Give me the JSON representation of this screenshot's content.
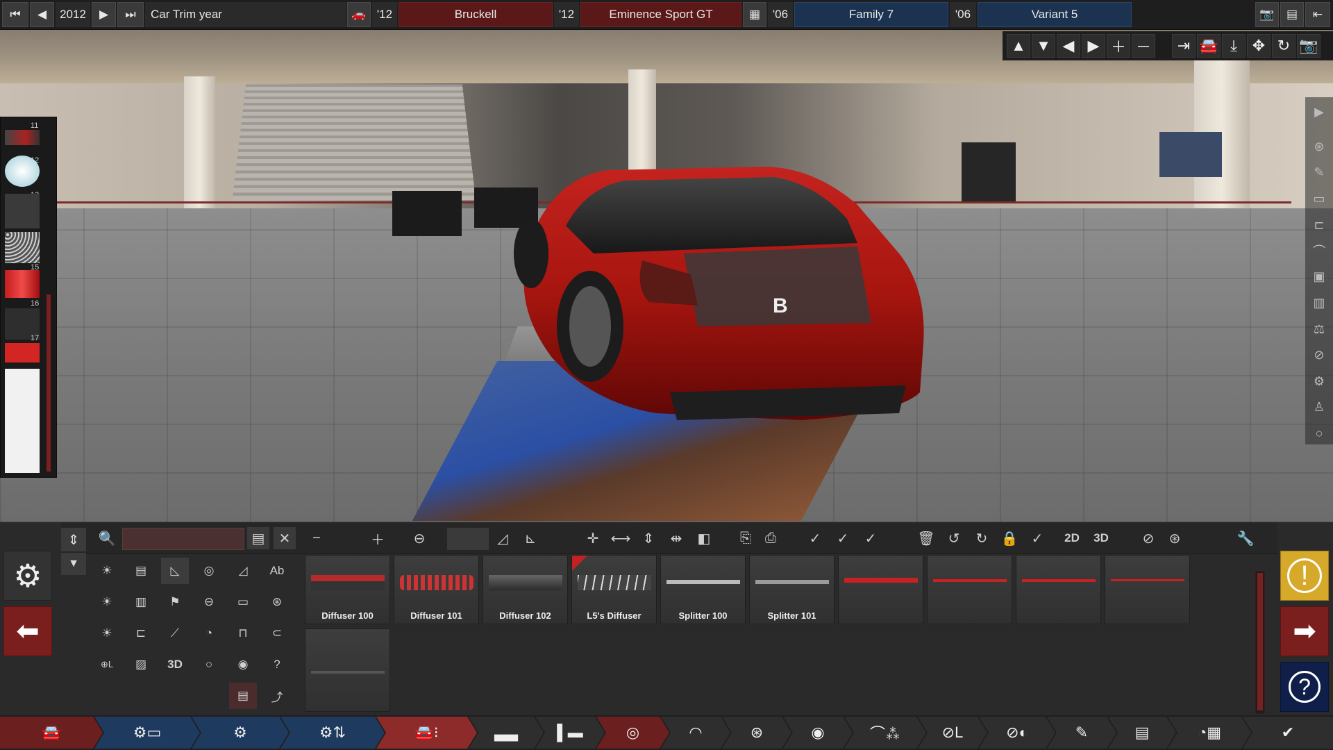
{
  "topbar": {
    "year": "2012",
    "year_label": "Car Trim year",
    "model_year": "'12",
    "model_name": "Bruckell",
    "trim_year": "'12",
    "trim_name": "Eminence Sport GT",
    "family_year": "'06",
    "family_name": "Family 7",
    "variant_year": "'06",
    "variant_name": "Variant 5"
  },
  "left_strip": {
    "swatches": [
      "11",
      "12",
      "13",
      "14",
      "15",
      "16",
      "17"
    ]
  },
  "toolbar": {
    "view_2d": "2D",
    "view_3d": "3D",
    "search_placeholder": ""
  },
  "categories": {
    "text_tool": "Ab",
    "three_d": "3D",
    "logo_label": "⊕L"
  },
  "parts": [
    {
      "name": "Diffuser 100"
    },
    {
      "name": "Diffuser 101"
    },
    {
      "name": "Diffuser 102"
    },
    {
      "name": "L5's Diffuser"
    },
    {
      "name": "Splitter 100"
    },
    {
      "name": "Splitter 101"
    },
    {
      "name": ""
    },
    {
      "name": ""
    },
    {
      "name": ""
    },
    {
      "name": ""
    }
  ],
  "colors": {
    "accent_red": "#7b1e1e",
    "accent_blue": "#1e3a5e",
    "warning": "#d7a92a"
  }
}
